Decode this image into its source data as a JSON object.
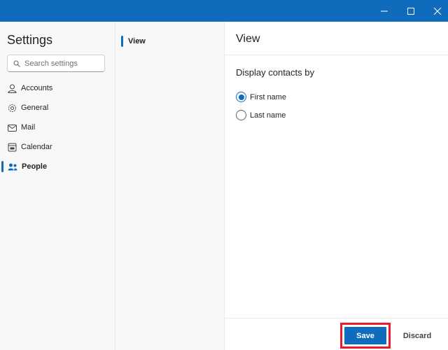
{
  "window": {
    "minimize": "—",
    "maximize": "☐",
    "close": "✕"
  },
  "sidebar": {
    "title": "Settings",
    "search_placeholder": "Search settings",
    "items": [
      {
        "label": "Accounts"
      },
      {
        "label": "General"
      },
      {
        "label": "Mail"
      },
      {
        "label": "Calendar"
      },
      {
        "label": "People"
      }
    ]
  },
  "subnav": {
    "items": [
      {
        "label": "View"
      }
    ]
  },
  "main": {
    "title": "View",
    "section": "Display contacts by",
    "options": [
      {
        "label": "First name",
        "selected": true
      },
      {
        "label": "Last name",
        "selected": false
      }
    ]
  },
  "footer": {
    "save": "Save",
    "discard": "Discard"
  },
  "colors": {
    "accent": "#0f6cbd",
    "highlight": "#e81c2c"
  }
}
